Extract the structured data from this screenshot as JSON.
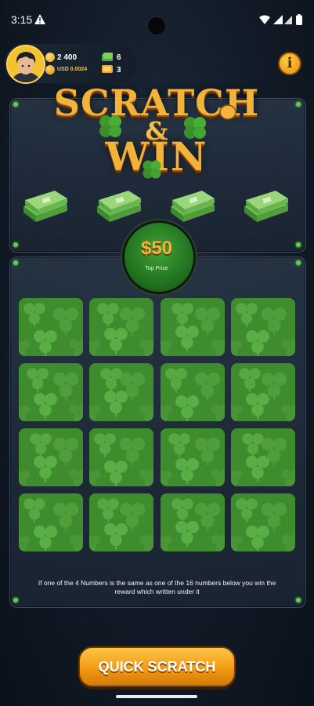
{
  "status_bar": {
    "time": "3:15"
  },
  "user": {
    "coins": "2 400",
    "usd": "USD 0.0024",
    "cash_count": "6",
    "ticket_count": "3"
  },
  "title": {
    "line1": "SCRATCH",
    "amp": "&",
    "line2": "WIN"
  },
  "prize": {
    "amount": "$50",
    "label": "Top Prize"
  },
  "rules_text": "If one of the 4 Numbers is the same as one of the 16 numbers below you win the reward which written under it",
  "quick_scratch_label": "QUICK SCRATCH",
  "info_label": "i",
  "colors": {
    "accent": "#f2b33a",
    "green": "#3c8a2c",
    "panel": "#1f2b3a"
  }
}
